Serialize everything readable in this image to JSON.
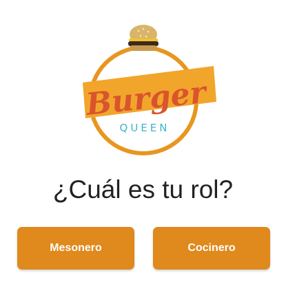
{
  "logo": {
    "brand_word": "Burger",
    "brand_sub": "QUEEN",
    "colors": {
      "ring": "#E8961F",
      "band": "#F2A52B",
      "script": "#D9542D",
      "sub": "#3FB5C4",
      "bun": "#D9B56A",
      "patty": "#3B2A1F",
      "cheese": "#F2C230"
    }
  },
  "question": "¿Cuál es tu rol?",
  "roles": {
    "mesonero_label": "Mesonero",
    "cocinero_label": "Cocinero"
  },
  "accent_color": "#E0891D"
}
